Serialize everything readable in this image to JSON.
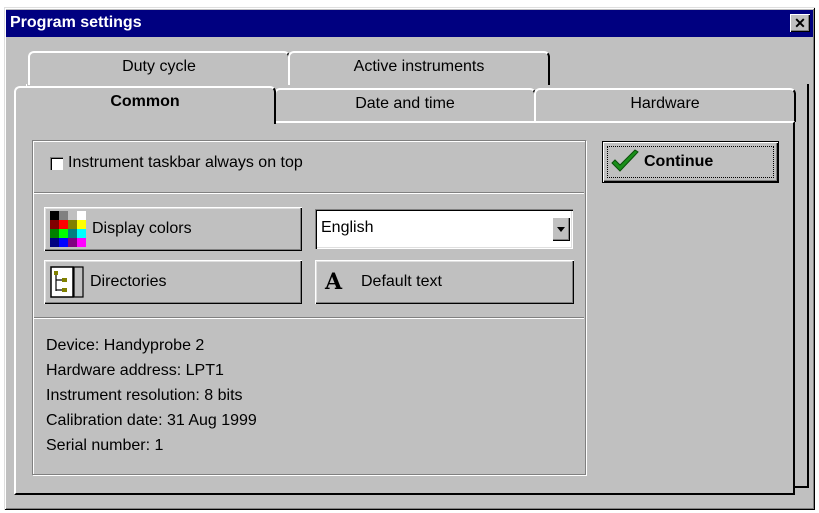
{
  "window": {
    "title": "Program settings",
    "close_glyph": "✕"
  },
  "tabs_back": [
    {
      "label": "Duty cycle"
    },
    {
      "label": "Active instruments"
    }
  ],
  "tabs_front": [
    {
      "label": "Common",
      "active": true
    },
    {
      "label": "Date and time"
    },
    {
      "label": "Hardware"
    }
  ],
  "common": {
    "taskbar_checkbox": {
      "label": "Instrument taskbar always on top",
      "checked": false
    },
    "display_colors_label": "Display colors",
    "directories_label": "Directories",
    "default_text_label": "Default text",
    "language": {
      "selected": "English"
    },
    "info": [
      "Device: Handyprobe 2",
      "Hardware address: LPT1",
      "Instrument resolution: 8 bits",
      "Calibration date: 31 Aug 1999",
      "Serial number: 1"
    ]
  },
  "continue_label": "Continue",
  "icons": {
    "palette": "palette-icon",
    "directories": "directory-tree-icon",
    "font": "font-icon",
    "check": "checkmark-icon"
  },
  "colors": {
    "titlebar": "#000080",
    "face": "#c0c0c0",
    "check_green": "#1a8f1a"
  }
}
